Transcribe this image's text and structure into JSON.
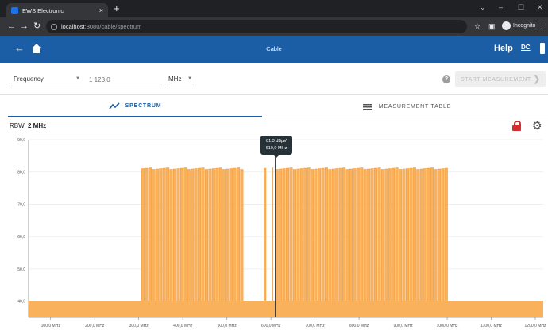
{
  "browser": {
    "tab_title": "EWS Electronic",
    "tab_close": "×",
    "new_tab": "+",
    "url_host": "localhost",
    "url_path": ":8080/cable/spectrum",
    "incognito_label": "Incognito"
  },
  "header": {
    "title": "Cable",
    "help_label": "Help",
    "dc_label": "DC"
  },
  "measurement": {
    "mode_value": "Frequency",
    "frequency_placeholder": "1 123,0",
    "unit_value": "MHz",
    "help_symbol": "?",
    "start_label": "START MEASUREMENT",
    "start_chevron": "❯"
  },
  "tabs": {
    "spectrum_label": "SPECTRUM",
    "table_label": "MEASUREMENT TABLE"
  },
  "chart_meta": {
    "rbw_label": "RBW:",
    "rbw_value": "2 MHz"
  },
  "tooltip": {
    "level": "81,3 dBµV",
    "frequency": "610,0 MHz"
  },
  "colors": {
    "header": "#1b5ea6",
    "spectrum_fill": "#f9b15c",
    "spectrum_line": "#f28c1e",
    "marker": "#333333"
  },
  "chart_data": {
    "type": "area",
    "title": "",
    "xlabel": "",
    "ylabel": "",
    "xlim": [
      50,
      1218
    ],
    "ylim": [
      35,
      90
    ],
    "x_ticks": [
      {
        "value": 100,
        "label": "100,0 MHz"
      },
      {
        "value": 200,
        "label": "200,0 MHz"
      },
      {
        "value": 300,
        "label": "300,0 MHz"
      },
      {
        "value": 400,
        "label": "400,0 MHz"
      },
      {
        "value": 500,
        "label": "500,0 MHz"
      },
      {
        "value": 600,
        "label": "600,0 MHz"
      },
      {
        "value": 700,
        "label": "700,0 MHz"
      },
      {
        "value": 800,
        "label": "800,0 MHz"
      },
      {
        "value": 900,
        "label": "900,0 MHz"
      },
      {
        "value": 1000,
        "label": "1000,0 MHz"
      },
      {
        "value": 1100,
        "label": "1100,0 MHz"
      },
      {
        "value": 1200,
        "label": "1200,0 MHz"
      }
    ],
    "y_ticks": [
      {
        "value": 40,
        "label": "40,0"
      },
      {
        "value": 50,
        "label": "50,0"
      },
      {
        "value": 60,
        "label": "60,0"
      },
      {
        "value": 70,
        "label": "70,0"
      },
      {
        "value": 80,
        "label": "80,0"
      },
      {
        "value": 90,
        "label": "90,0"
      }
    ],
    "noise_floor": 40,
    "channel_bands": [
      {
        "start": 306,
        "end": 538,
        "level": 81
      },
      {
        "start": 584,
        "end": 590,
        "level": 81
      },
      {
        "start": 602,
        "end": 606,
        "level": 81
      },
      {
        "start": 610,
        "end": 1004,
        "level": 81
      }
    ],
    "channel_width": 8,
    "marker": {
      "x": 610.0,
      "y": 81.3
    }
  }
}
